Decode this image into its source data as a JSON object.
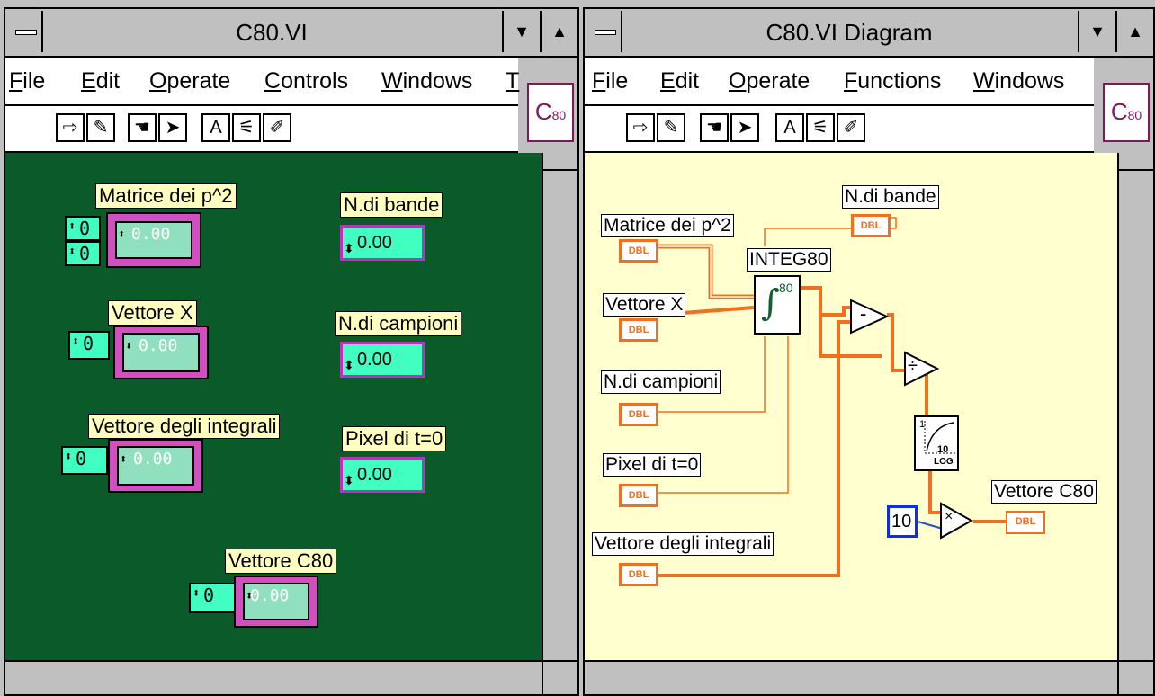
{
  "left_window": {
    "title": "C80.VI",
    "menus": [
      "File",
      "Edit",
      "Operate",
      "Controls",
      "Windows",
      "T"
    ],
    "badge": {
      "main": "C",
      "sub": "80"
    },
    "panel_color": "#0a5a2a",
    "controls": {
      "matrice": {
        "label": "Matrice dei p^2",
        "index1": "0",
        "index2": "0",
        "value": "0.00"
      },
      "vettore_x": {
        "label": "Vettore X",
        "index": "0",
        "value": "0.00"
      },
      "vettore_integrali": {
        "label": "Vettore degli integrali",
        "index": "0",
        "value": "0.00"
      },
      "vettore_c80": {
        "label": "Vettore C80",
        "index": "0",
        "value": "0.00"
      },
      "n_bande": {
        "label": "N.di bande",
        "value": "0.00"
      },
      "n_campioni": {
        "label": "N.di campioni",
        "value": "0.00"
      },
      "pixel_t0": {
        "label": "Pixel di t=0",
        "value": "0.00"
      }
    }
  },
  "right_window": {
    "title": "C80.VI Diagram",
    "menus": [
      "File",
      "Edit",
      "Operate",
      "Functions",
      "Windows"
    ],
    "badge": {
      "main": "C",
      "sub": "80"
    },
    "panel_color": "#ffffd0",
    "wire_color": "#f07020",
    "terminal_text": "DBL",
    "nodes": {
      "matrice": "Matrice dei p^2",
      "vettore_x": "Vettore X",
      "n_campioni": "N.di campioni",
      "pixel_t0": "Pixel di t=0",
      "vettore_integrali": "Vettore degli integrali",
      "n_bande": "N.di bande",
      "subvi": "INTEG80",
      "subvi_icon_text": "80",
      "log_icon_top": "1",
      "log_icon_bottom": "10",
      "log_icon_label": "LOG",
      "subtract": "-",
      "divide": "÷",
      "multiply": "×",
      "constant": "10",
      "vettore_c80": "Vettore C80"
    }
  }
}
